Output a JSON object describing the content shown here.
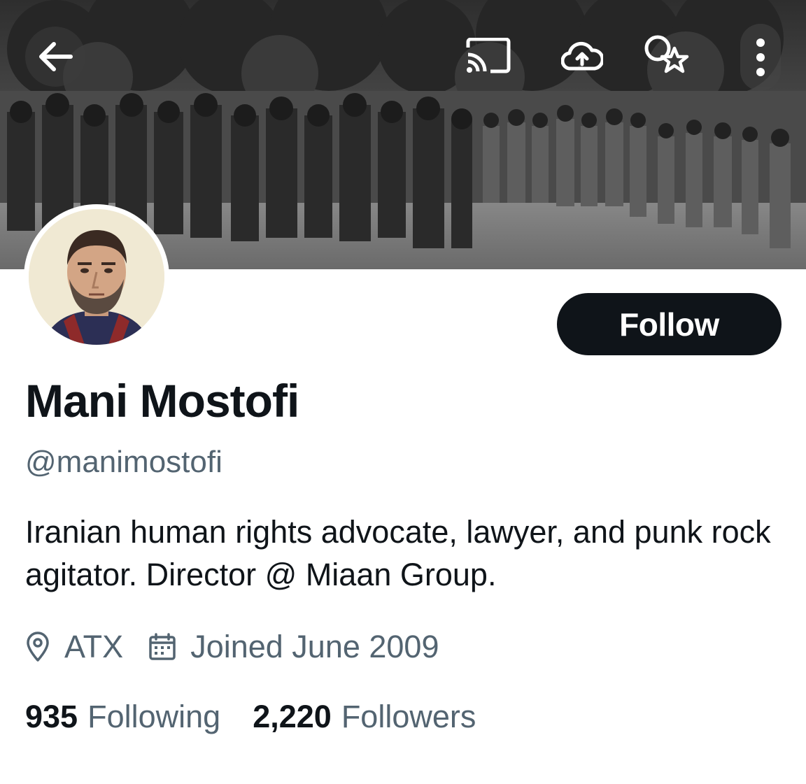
{
  "header": {
    "back_icon": "arrow-left-icon",
    "cast_icon": "cast-icon",
    "upload_icon": "cloud-upload-icon",
    "search_icon": "search-star-icon",
    "more_icon": "more-vertical-icon"
  },
  "profile": {
    "name": "Mani Mostofi",
    "handle": "@manimostofi",
    "bio": "Iranian human rights advocate, lawyer, and punk rock agitator. Director @ Miaan Group.",
    "location": "ATX",
    "joined": "Joined June 2009",
    "following_count": "935",
    "following_label": "Following",
    "followers_count": "2,220",
    "followers_label": "Followers"
  },
  "actions": {
    "follow_label": "Follow"
  },
  "colors": {
    "text_primary": "#0f1419",
    "text_secondary": "#536471",
    "button_bg": "#0f1419",
    "button_text": "#ffffff",
    "background": "#ffffff"
  }
}
